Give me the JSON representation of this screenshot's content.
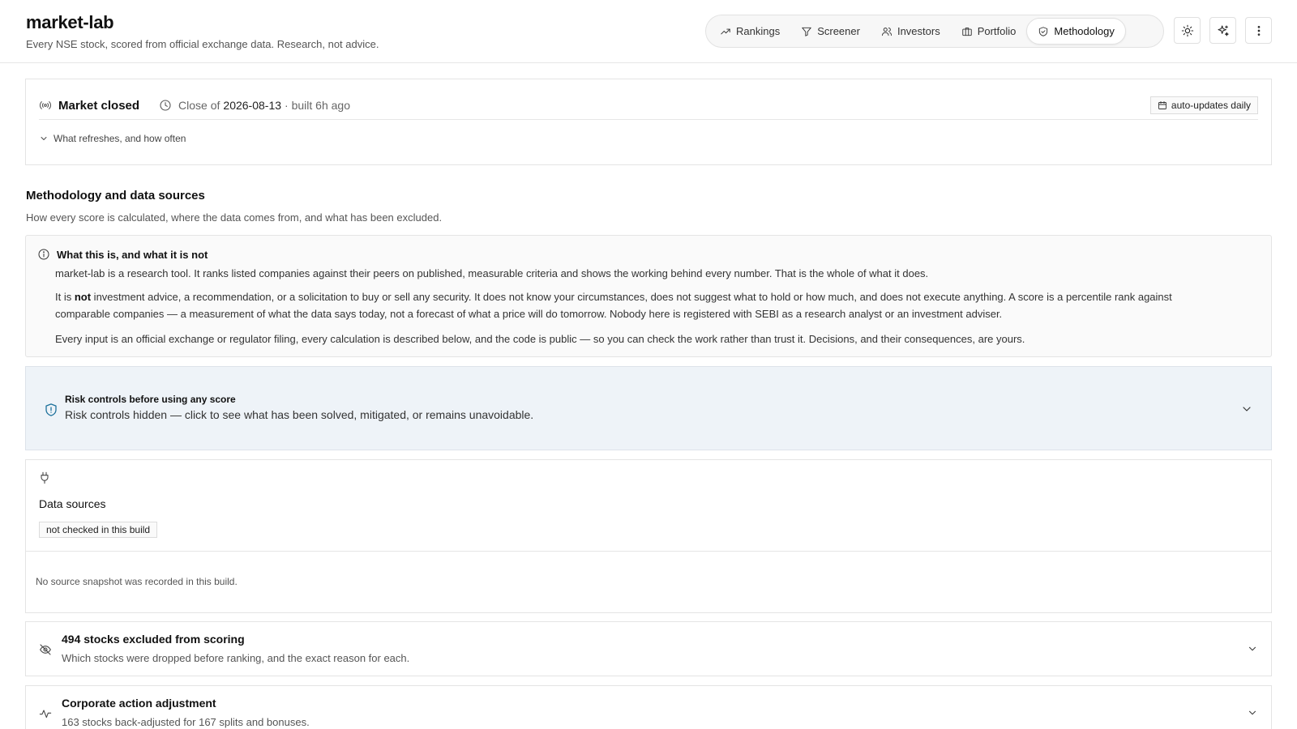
{
  "header": {
    "title": "market-lab",
    "subtitle": "Every NSE stock, scored from official exchange data. Research, not advice.",
    "nav": [
      {
        "label": "Rankings",
        "icon": "trending-up-icon"
      },
      {
        "label": "Screener",
        "icon": "filter-icon"
      },
      {
        "label": "Investors",
        "icon": "users-icon"
      },
      {
        "label": "Portfolio",
        "icon": "briefcase-icon"
      },
      {
        "label": "Methodology",
        "icon": "shield-check-icon",
        "active": true
      }
    ],
    "actions": [
      "sun-icon",
      "sparkles-icon",
      "more-vertical-icon"
    ]
  },
  "status": {
    "market_state": "Market closed",
    "close_prefix": "Close of",
    "close_date": "2026-08-13",
    "built": "· built 6h ago",
    "auto_badge": "auto-updates daily",
    "refresh_toggle": "What refreshes, and how often"
  },
  "methodology": {
    "title": "Methodology and data sources",
    "subtitle": "How every score is calculated, where the data comes from, and what has been excluded."
  },
  "disclaimer": {
    "heading": "What this is, and what it is not",
    "p1": "market-lab is a research tool. It ranks listed companies against their peers on published, measurable criteria and shows the working behind every number. That is the whole of what it does.",
    "p2_prefix": "It is ",
    "p2_bold": "not",
    "p2_rest": " investment advice, a recommendation, or a solicitation to buy or sell any security. It does not know your circumstances, does not suggest what to hold or how much, and does not execute anything. A score is a percentile rank against comparable companies — a measurement of what the data says today, not a forecast of what a price will do tomorrow. Nobody here is registered with SEBI as a research analyst or an investment adviser.",
    "p3": "Every input is an official exchange or regulator filing, every calculation is described below, and the code is public — so you can check the work rather than trust it. Decisions, and their consequences, are yours."
  },
  "risk": {
    "title": "Risk controls before using any score",
    "desc": "Risk controls hidden — click to see what has been solved, mitigated, or remains unavoidable."
  },
  "sources": {
    "title": "Data sources",
    "badge": "not checked in this build",
    "empty": "No source snapshot was recorded in this build."
  },
  "excluded": {
    "title": "494 stocks excluded from scoring",
    "sub": "Which stocks were dropped before ranking, and the exact reason for each."
  },
  "corporate": {
    "title": "Corporate action adjustment",
    "sub": "163 stocks back-adjusted for 167 splits and bonuses."
  },
  "colors": {
    "accent_blue": "#1a6f9a",
    "risk_bg": "#eef3f8"
  }
}
